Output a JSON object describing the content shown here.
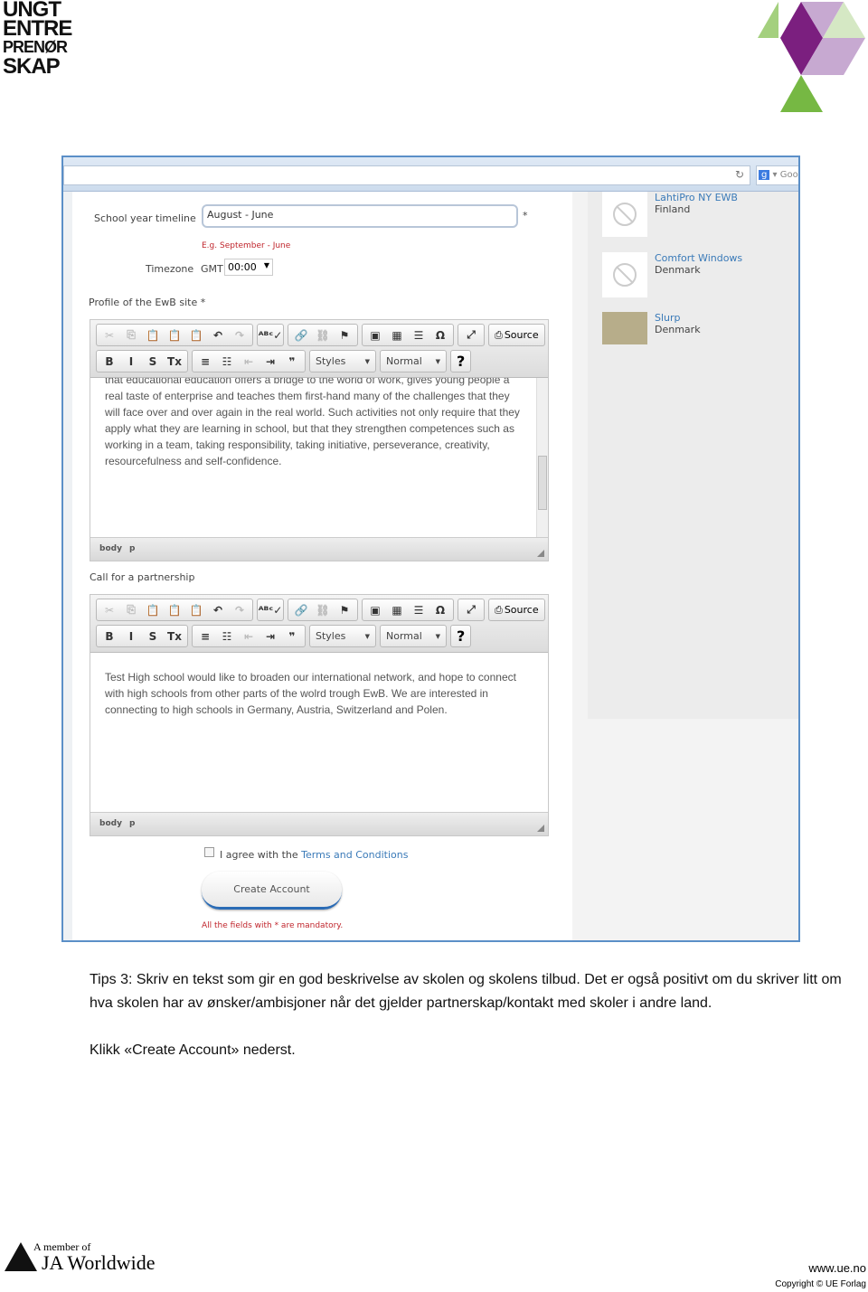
{
  "header": {
    "logo_lines": [
      "UNGT",
      "ENTRE",
      "PRENØR",
      "SKAP"
    ],
    "brand_colors": [
      "#7b1f7f",
      "#c7a9d1",
      "#76b843",
      "#d5e8c4"
    ]
  },
  "browser": {
    "search_placeholder": "Goo"
  },
  "form": {
    "school_year_label": "School year timeline",
    "school_year_value": "August - June",
    "required_mark": "*",
    "school_year_hint": "E.g. September - June",
    "timezone_label": "Timezone",
    "timezone_prefix": "GMT",
    "timezone_value": "00:00",
    "profile_label": "Profile of the EwB site *",
    "profile_text": "that educational education offers a bridge to the world of work, gives young people a real taste of enterprise and teaches them first-hand many of the challenges that they will face over and over again in the real world. Such activities not only require that they apply what they are learning in school, but that they strengthen competences such as working in a team, taking responsibility, taking initiative, perseverance, creativity, resourcefulness and self-confidence.",
    "partnership_label": "Call for a partnership",
    "partnership_text": "Test High school would like to broaden our international network, and hope to connect with high schools from other parts of the wolrd trough EwB. We are interested in connecting to high schools in Germany, Austria, Switzerland and Polen.",
    "agree_text": "I agree with the ",
    "terms_link": "Terms and Conditions",
    "agree_checked": false,
    "create_button": "Create Account",
    "mandatory_note": "All the fields with * are mandatory."
  },
  "editor": {
    "source_label": "Source",
    "styles_label": "Styles",
    "format_label": "Normal",
    "help_label": "?",
    "status_path": [
      "body",
      "p"
    ]
  },
  "partners": [
    {
      "name": "LahtiPro NY EWB",
      "country": "Finland"
    },
    {
      "name": "Comfort Windows",
      "country": "Denmark"
    },
    {
      "name": "Slurp",
      "country": "Denmark"
    }
  ],
  "tips": {
    "paragraph1": "Tips 3: Skriv en tekst som gir en god beskrivelse av skolen og skolens tilbud. Det er også positivt om du skriver litt om hva skolen har av ønsker/ambisjoner når det gjelder partnerskap/kontakt med skoler i andre land.",
    "paragraph2": "Klikk «Create Account» nederst."
  },
  "footer": {
    "member_of": "A member of",
    "ja": "JA Worldwide",
    "website": "www.ue.no",
    "copyright": "Copyright © UE Forlag"
  }
}
